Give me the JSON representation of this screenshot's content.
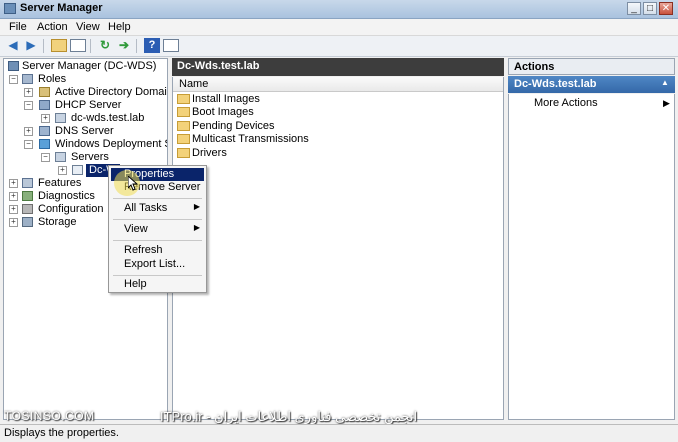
{
  "window": {
    "title": "Server Manager",
    "controls": [
      "_",
      "□",
      "✕"
    ]
  },
  "menubar": {
    "items": [
      "File",
      "Action",
      "View",
      "Help"
    ]
  },
  "toolbar": {
    "icons": [
      "back-icon",
      "forward-icon",
      "up-folder-icon",
      "show-hide-tree-icon",
      "refresh-icon",
      "export-icon",
      "help-icon",
      "properties-icon"
    ]
  },
  "tree": {
    "root": "Server Manager (DC-WDS)",
    "roles": "Roles",
    "ad": "Active Directory Domain Se",
    "dhcp": "DHCP Server",
    "dhcp_child": "dc-wds.test.lab",
    "dns": "DNS Server",
    "wds": "Windows Deployment Servi",
    "servers": "Servers",
    "selected": "Dc-W",
    "features": "Features",
    "diagnostics": "Diagnostics",
    "configuration": "Configuration",
    "storage": "Storage"
  },
  "main": {
    "header": "Dc-Wds.test.lab",
    "column": "Name",
    "items": [
      "Install Images",
      "Boot Images",
      "Pending Devices",
      "Multicast Transmissions",
      "Drivers"
    ]
  },
  "actions": {
    "header": "Actions",
    "section": "Dc-Wds.test.lab",
    "items": [
      "More Actions"
    ]
  },
  "context_menu": {
    "properties": "Properties",
    "remove": "Remove Server",
    "all_tasks": "All Tasks",
    "view": "View",
    "refresh": "Refresh",
    "export": "Export List...",
    "help": "Help"
  },
  "watermark": {
    "left": "TOSINSO.COM",
    "right": "انجمن تخصصی فناوری اطلاعات ایران - ITPro.ir"
  },
  "status": {
    "text": "Displays the properties."
  },
  "colors": {
    "selection": "#0a246a",
    "accent": "#3d6fb0",
    "header_dark": "#3d3d3d"
  }
}
